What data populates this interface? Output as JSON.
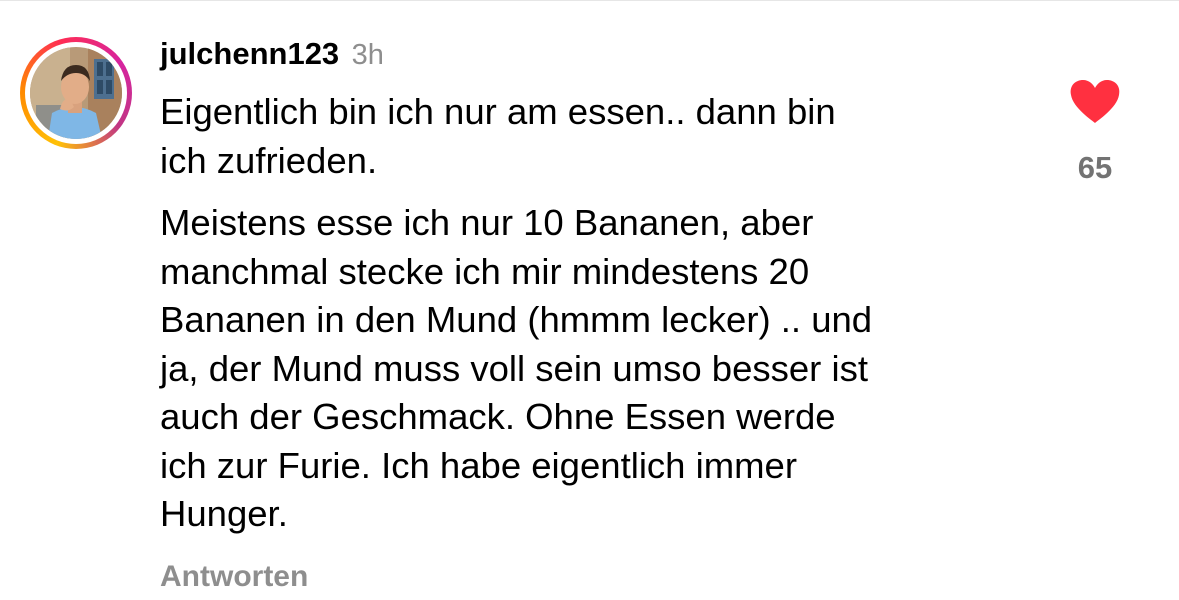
{
  "comment": {
    "username": "julchenn123",
    "time": "3h",
    "paragraphs": [
      "Eigentlich bin ich nur am essen.. dann bin\nich zufrieden.",
      "Meistens esse ich nur 10 Bananen, aber\nmanchmal stecke ich mir mindestens 20\nBananen in den Mund (hmmm lecker) .. und\nja, der Mund muss voll sein umso besser ist\nauch der Geschmack. Ohne Essen werde\nich zur Furie. Ich habe eigentlich immer\nHunger."
    ],
    "reply_label": "Antworten",
    "like_count": "65",
    "liked": true
  },
  "colors": {
    "heart": "#ff3040",
    "secondary_text": "#8e8e8e",
    "like_count_text": "#737373"
  },
  "icons": {
    "like": "heart-filled-icon",
    "avatar": "profile-photo"
  }
}
